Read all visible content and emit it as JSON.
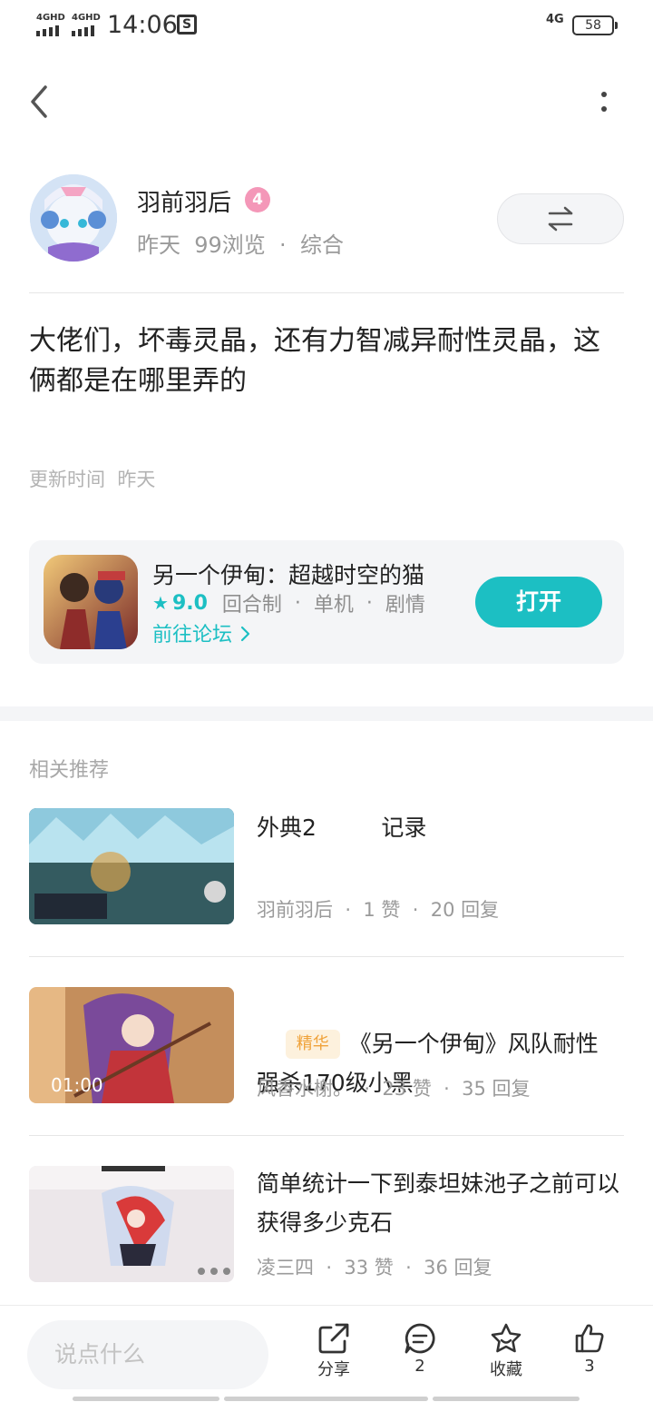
{
  "status_bar": {
    "sim1_label": "4GHD",
    "sim2_label": "4GHD",
    "time": "14:06",
    "network_label": "4G",
    "battery": "58"
  },
  "author": {
    "name": "羽前羽后",
    "level": "4",
    "meta": "昨天  99浏览  ·  综合"
  },
  "post": {
    "content": "大佬们，坏毒灵晶，还有力智减异耐性灵晶，这俩都是在哪里弄的",
    "update_time": "更新时间  昨天"
  },
  "game_card": {
    "title": "另一个伊甸：超越时空的猫",
    "rating": "9.0",
    "tags": [
      "回合制",
      "单机",
      "剧情"
    ],
    "forum_link": "前往论坛",
    "open_label": "打开"
  },
  "recommend": {
    "section_title": "相关推荐",
    "items": [
      {
        "title": "外典2         记录",
        "tag": "",
        "meta": "羽前羽后  ·  1 赞  ·  20 回复",
        "duration": ""
      },
      {
        "title": "《另一个伊甸》风队耐性强杀170级小黑",
        "tag": "精华",
        "meta": "风香水榭。  ·  23 赞  ·  35 回复",
        "duration": "01:00"
      },
      {
        "title": "简单统计一下到泰坦妹池子之前可以获得多少克石",
        "tag": "",
        "meta": "凌三四  ·  33 赞  ·  36 回复",
        "duration": ""
      }
    ]
  },
  "bottom_bar": {
    "comment_placeholder": "说点什么",
    "share_label": "分享",
    "comment_count": "2",
    "favorite_label": "收藏",
    "like_count": "3"
  },
  "colors": {
    "accent": "#1cbfc3",
    "level_badge": "#f497b8",
    "essence_tag": "#f0a23a"
  }
}
